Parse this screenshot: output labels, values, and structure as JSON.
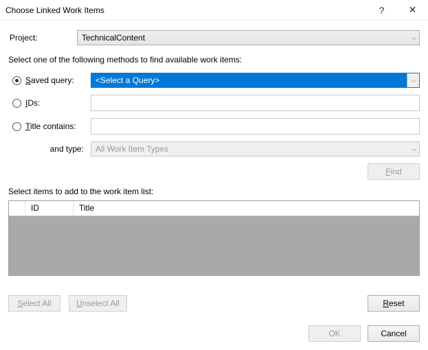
{
  "window": {
    "title": "Choose Linked Work Items",
    "help_glyph": "?",
    "close_glyph": "✕"
  },
  "project": {
    "label": "Project:",
    "value": "TechnicalContent"
  },
  "instruction": "Select one of the following methods to find available work items:",
  "methods": {
    "saved_query": {
      "label_pre": "S",
      "label_post": "aved query:",
      "selected": "<Select a Query>"
    },
    "ids": {
      "label_pre": "I",
      "label_post": "Ds:"
    },
    "title_contains": {
      "label_pre": "T",
      "label_post": "itle contains:"
    },
    "and_type": {
      "label": "and type:",
      "value": "All Work Item Types"
    }
  },
  "find_button": {
    "pre": "F",
    "post": "ind"
  },
  "grid": {
    "heading": "Select items to add to the work item list:",
    "col_id": "ID",
    "col_title": "Title"
  },
  "buttons": {
    "select_all_pre": "S",
    "select_all_post": "elect All",
    "unselect_all_pre": "U",
    "unselect_all_post": "nselect All",
    "reset_pre": "R",
    "reset_post": "eset",
    "ok": "OK",
    "cancel": "Cancel"
  }
}
